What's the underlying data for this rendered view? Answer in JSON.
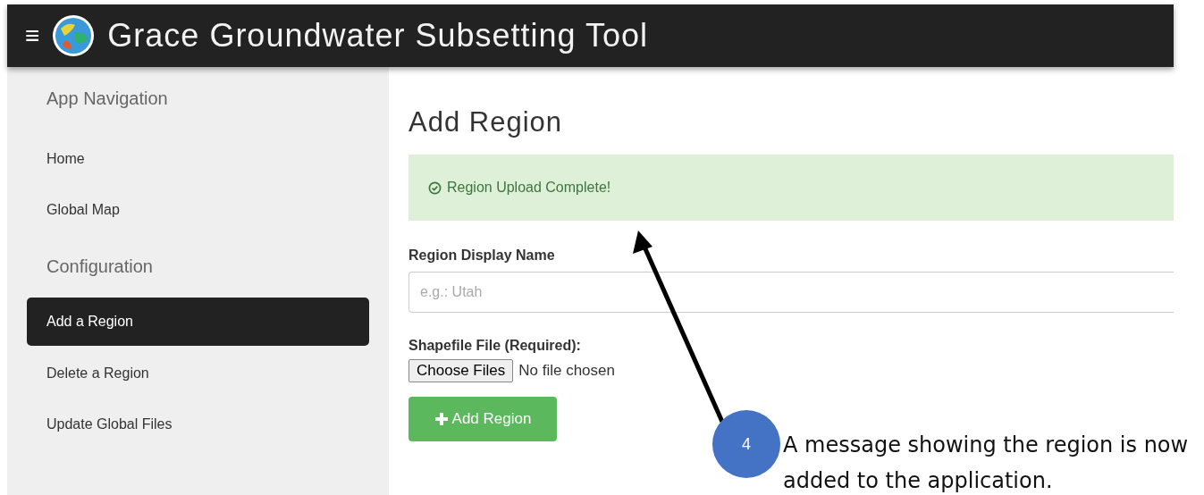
{
  "header": {
    "menu_glyph": "≡",
    "title": "Grace Groundwater Subsetting Tool"
  },
  "sidebar": {
    "items": [
      {
        "kind": "heading",
        "label": "App Navigation"
      },
      {
        "kind": "link",
        "label": "Home",
        "selected": false
      },
      {
        "kind": "link",
        "label": "Global Map",
        "selected": false
      },
      {
        "kind": "heading",
        "label": "Configuration"
      },
      {
        "kind": "link",
        "label": "Add a Region",
        "selected": true
      },
      {
        "kind": "link",
        "label": "Delete a Region",
        "selected": false
      },
      {
        "kind": "link",
        "label": "Update Global Files",
        "selected": false
      }
    ]
  },
  "content": {
    "title": "Add Region",
    "alert": "Region Upload Complete!",
    "name_label": "Region Display Name",
    "name_placeholder": "e.g.: Utah",
    "file_label": "Shapefile File (Required):",
    "file_button": "Choose Files",
    "file_status": "No file chosen",
    "submit": "Add Region"
  },
  "callout": {
    "number": "4",
    "lines": [
      "A message showing the region is now",
      "added to the application."
    ]
  }
}
